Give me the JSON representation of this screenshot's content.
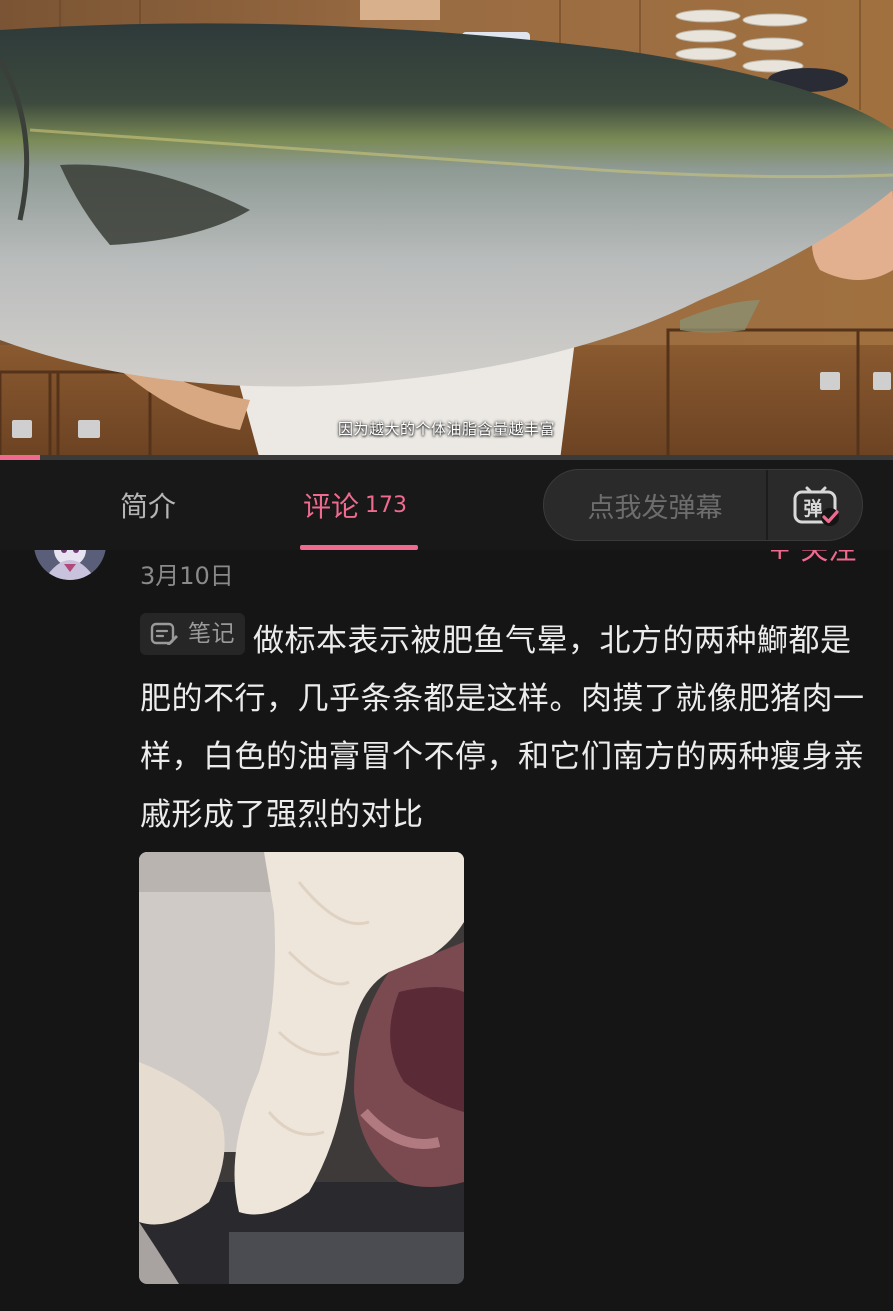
{
  "video": {
    "subtitle": "因为越大的个体油脂含量越丰富",
    "progress": 0.045,
    "accent_color": "#f06a8f"
  },
  "tabs": {
    "intro_label": "简介",
    "comments_label": "评论",
    "comments_count": "173"
  },
  "danmaku": {
    "placeholder": "点我发弹幕",
    "icon": "danmaku-toggle-icon",
    "icon_glyph": "弹"
  },
  "comment": {
    "follow_label": "+ 关注",
    "date": "3月10日",
    "note_tag": "笔记",
    "note_icon": "note-edit-icon",
    "text": "做标本表示被肥鱼气晕，北方的两种鰤都是肥的不行，几乎条条都是这样。肉摸了就像肥猪肉一样，白色的油膏冒个不停，和它们南方的两种瘦身亲戚形成了强烈的对比",
    "image_alt": "fish-fillet-photo"
  }
}
